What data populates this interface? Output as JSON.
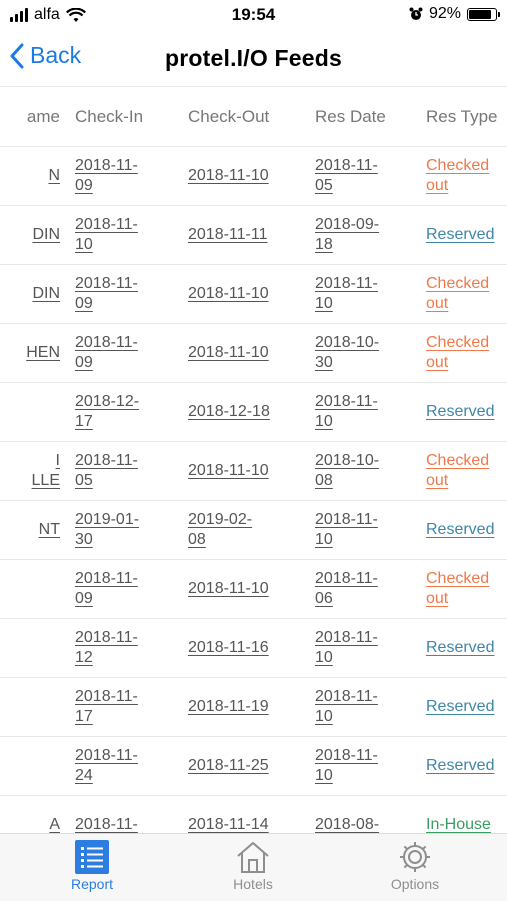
{
  "status_bar": {
    "carrier": "alfa",
    "time": "19:54",
    "battery_pct": "92%",
    "battery_level": 0.92
  },
  "nav": {
    "back_label": "Back",
    "title": "protel.I/O Feeds"
  },
  "table": {
    "headers": [
      "ame",
      "Check-In",
      "Check-Out",
      "Res Date",
      "Res Type"
    ],
    "rows": [
      {
        "name": "N",
        "check_in": "2018-11-\n09",
        "check_out": "2018-11-10",
        "res_date": "2018-11-\n05",
        "res_type": "Checked\nout",
        "kind": "out"
      },
      {
        "name": "DIN",
        "check_in": "2018-11-\n10",
        "check_out": "2018-11-11",
        "res_date": "2018-09-\n18",
        "res_type": "Reserved",
        "kind": "res"
      },
      {
        "name": "DIN",
        "check_in": "2018-11-\n09",
        "check_out": "2018-11-10",
        "res_date": "2018-11-\n10",
        "res_type": "Checked\nout",
        "kind": "out"
      },
      {
        "name": "HEN",
        "check_in": "2018-11-\n09",
        "check_out": "2018-11-10",
        "res_date": "2018-10-\n30",
        "res_type": "Checked\nout",
        "kind": "out"
      },
      {
        "name": "",
        "check_in": "2018-12-\n17",
        "check_out": "2018-12-18",
        "res_date": "2018-11-\n10",
        "res_type": "Reserved",
        "kind": "res"
      },
      {
        "name": "I\nLLE",
        "check_in": "2018-11-\n05",
        "check_out": "2018-11-10",
        "res_date": "2018-10-\n08",
        "res_type": "Checked\nout",
        "kind": "out"
      },
      {
        "name": "NT",
        "check_in": "2019-01-\n30",
        "check_out": "2019-02-\n08",
        "res_date": "2018-11-\n10",
        "res_type": "Reserved",
        "kind": "res"
      },
      {
        "name": "",
        "check_in": "2018-11-\n09",
        "check_out": "2018-11-10",
        "res_date": "2018-11-\n06",
        "res_type": "Checked\nout",
        "kind": "out"
      },
      {
        "name": "",
        "check_in": "2018-11-\n12",
        "check_out": "2018-11-16",
        "res_date": "2018-11-\n10",
        "res_type": "Reserved",
        "kind": "res"
      },
      {
        "name": "",
        "check_in": "2018-11-\n17",
        "check_out": "2018-11-19",
        "res_date": "2018-11-\n10",
        "res_type": "Reserved",
        "kind": "res"
      },
      {
        "name": "",
        "check_in": "2018-11-\n24",
        "check_out": "2018-11-25",
        "res_date": "2018-11-\n10",
        "res_type": "Reserved",
        "kind": "res"
      },
      {
        "name": "A",
        "check_in": "2018-11-",
        "check_out": "2018-11-14",
        "res_date": "2018-08-",
        "res_type": "In-House",
        "kind": "inh"
      }
    ]
  },
  "tabs": [
    {
      "label": "Report",
      "icon": "list-icon",
      "active": true
    },
    {
      "label": "Hotels",
      "icon": "house-icon",
      "active": false
    },
    {
      "label": "Options",
      "icon": "gear-icon",
      "active": false
    }
  ],
  "colors": {
    "accent": "#2d7de0",
    "checked_out": "#f0784a",
    "reserved": "#3f86a8",
    "in_house": "#3a9c63"
  }
}
